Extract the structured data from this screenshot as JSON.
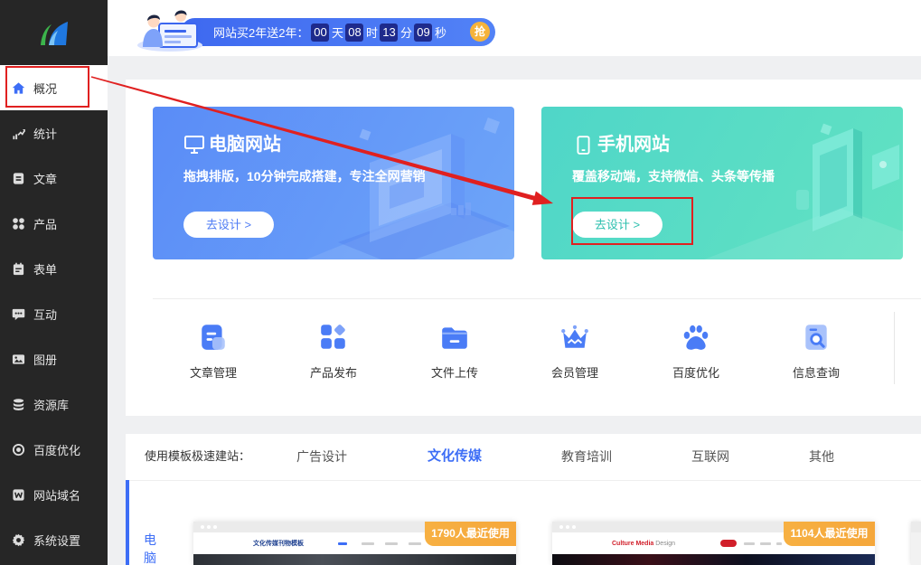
{
  "colors": {
    "sidebar_bg": "#262626",
    "accent": "#3d6ef6",
    "pc_card": "#5a8cf7",
    "mobile_card": "#4fd6c8",
    "badge": "#f5a73b",
    "annotation": "#e02020",
    "countdown_box": "#1e2a8c",
    "grab": "#f6b33a"
  },
  "sidebar": {
    "logo": "logo-icon",
    "items": [
      {
        "label": "概况",
        "icon": "home-icon",
        "active": true
      },
      {
        "label": "统计",
        "icon": "chart-icon"
      },
      {
        "label": "文章",
        "icon": "article-icon"
      },
      {
        "label": "产品",
        "icon": "grid-icon"
      },
      {
        "label": "表单",
        "icon": "form-icon"
      },
      {
        "label": "互动",
        "icon": "chat-icon"
      },
      {
        "label": "图册",
        "icon": "image-icon"
      },
      {
        "label": "资源库",
        "icon": "database-icon"
      },
      {
        "label": "百度优化",
        "icon": "target-icon"
      },
      {
        "label": "网站域名",
        "icon": "domain-icon"
      },
      {
        "label": "系统设置",
        "icon": "gear-icon"
      }
    ]
  },
  "promo": {
    "text": "网站买2年送2年：",
    "countdown": [
      {
        "value": "00",
        "unit": "天"
      },
      {
        "value": "08",
        "unit": "时"
      },
      {
        "value": "13",
        "unit": "分"
      },
      {
        "value": "09",
        "unit": "秒"
      }
    ],
    "cta": "抢"
  },
  "design_cards": [
    {
      "title": "电脑网站",
      "icon": "monitor-icon",
      "description": "拖拽排版，10分钟完成搭建，专注全网营销",
      "button": "去设计 >"
    },
    {
      "title": "手机网站",
      "icon": "phone-icon",
      "description": "覆盖移动端，支持微信、头条等传播",
      "button": "去设计 >"
    }
  ],
  "quick_links": [
    {
      "label": "文章管理",
      "icon": "article-manage-icon"
    },
    {
      "label": "产品发布",
      "icon": "product-publish-icon"
    },
    {
      "label": "文件上传",
      "icon": "folder-icon"
    },
    {
      "label": "会员管理",
      "icon": "crown-icon"
    },
    {
      "label": "百度优化",
      "icon": "paw-icon"
    },
    {
      "label": "信息查询",
      "icon": "search-doc-icon"
    }
  ],
  "templates": {
    "intro": "使用模板极速建站：",
    "tabs": [
      {
        "label": "广告设计"
      },
      {
        "label": "文化传媒",
        "active": true
      },
      {
        "label": "教育培训"
      },
      {
        "label": "互联网"
      },
      {
        "label": "其他"
      }
    ],
    "device_label": "电脑",
    "items": [
      {
        "usage": "1790人最近使用",
        "site_title": "文化传媒刊物模板"
      },
      {
        "usage": "1104人最近使用",
        "site_title": "Culture Media",
        "site_subtitle": "Design"
      }
    ]
  }
}
